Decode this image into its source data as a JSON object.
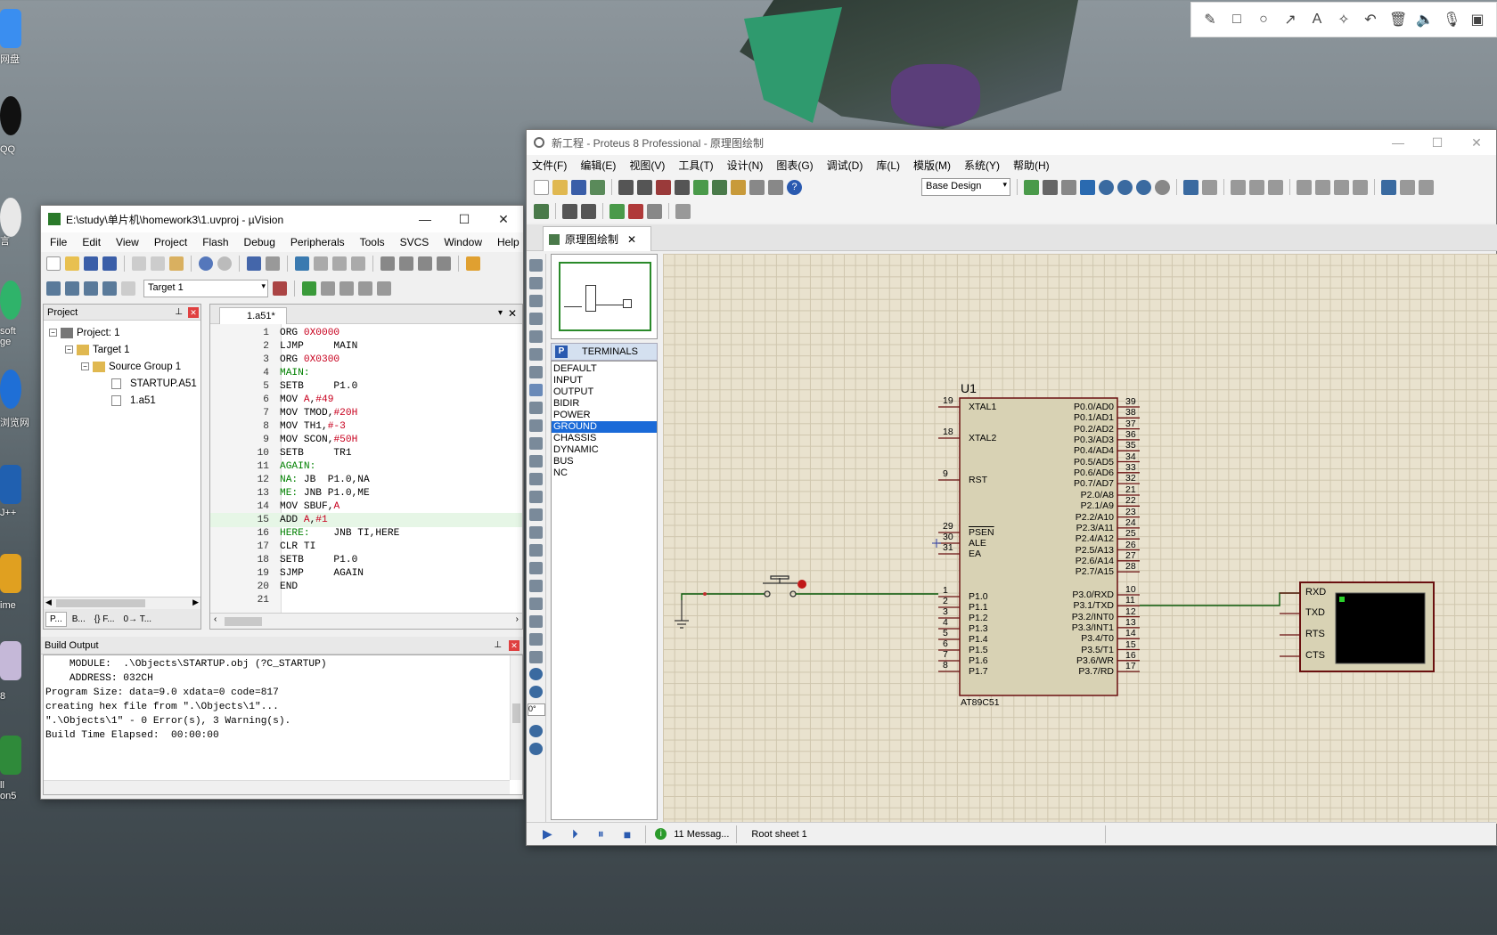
{
  "desktop": {
    "labels": [
      "网盘",
      "QQ",
      "言",
      "soft\nge",
      "浏览网",
      "J++",
      "ime",
      "8",
      "ll\non5"
    ]
  },
  "uvision": {
    "title": "E:\\study\\单片机\\homework3\\1.uvproj - µVision",
    "menu": [
      "File",
      "Edit",
      "View",
      "Project",
      "Flash",
      "Debug",
      "Peripherals",
      "Tools",
      "SVCS",
      "Window",
      "Help"
    ],
    "target": "Target 1",
    "project_panel_title": "Project",
    "tree": [
      {
        "label": "Project: 1",
        "level": 0
      },
      {
        "label": "Target 1",
        "level": 1
      },
      {
        "label": "Source Group 1",
        "level": 2
      },
      {
        "label": "STARTUP.A51",
        "level": 3
      },
      {
        "label": "1.a51",
        "level": 3
      }
    ],
    "panel_tabs": [
      "P...",
      "B...",
      "{} F...",
      "0→ T..."
    ],
    "editor_tab": "1.a51*",
    "code": [
      {
        "n": "1",
        "t": "ORG 0X0000"
      },
      {
        "n": "2",
        "t": "LJMP     MAIN"
      },
      {
        "n": "3",
        "t": "ORG 0X0300"
      },
      {
        "n": "4",
        "t": "MAIN:"
      },
      {
        "n": "5",
        "t": "SETB     P1.0"
      },
      {
        "n": "6",
        "t": "MOV A,#49"
      },
      {
        "n": "7",
        "t": "MOV TMOD,#20H"
      },
      {
        "n": "8",
        "t": "MOV TH1,#-3"
      },
      {
        "n": "9",
        "t": "MOV SCON,#50H"
      },
      {
        "n": "10",
        "t": "SETB     TR1"
      },
      {
        "n": "11",
        "t": "AGAIN:"
      },
      {
        "n": "12",
        "t": "NA: JB  P1.0,NA"
      },
      {
        "n": "13",
        "t": "ME: JNB P1.0,ME"
      },
      {
        "n": "14",
        "t": "MOV SBUF,A"
      },
      {
        "n": "15",
        "t": "ADD A,#1"
      },
      {
        "n": "16",
        "t": "HERE:    JNB TI,HERE"
      },
      {
        "n": "17",
        "t": "CLR TI"
      },
      {
        "n": "18",
        "t": "SETB     P1.0"
      },
      {
        "n": "19",
        "t": "SJMP     AGAIN"
      },
      {
        "n": "20",
        "t": "END"
      },
      {
        "n": "21",
        "t": ""
      }
    ],
    "build_title": "Build Output",
    "build": [
      "    MODULE:  .\\Objects\\STARTUP.obj (?C_STARTUP)",
      "    ADDRESS: 032CH",
      "Program Size: data=9.0 xdata=0 code=817",
      "creating hex file from \".\\Objects\\1\"...",
      "\".\\Objects\\1\" - 0 Error(s), 3 Warning(s).",
      "Build Time Elapsed:  00:00:00"
    ]
  },
  "proteus": {
    "title": "新工程 - Proteus 8 Professional - 原理图绘制",
    "menu": [
      "文件(F)",
      "编辑(E)",
      "视图(V)",
      "工具(T)",
      "设计(N)",
      "图表(G)",
      "调试(D)",
      "库(L)",
      "模版(M)",
      "系统(Y)",
      "帮助(H)"
    ],
    "design_select": "Base Design",
    "tab": "原理图绘制",
    "terminals_title": "TERMINALS",
    "terminals": [
      "DEFAULT",
      "INPUT",
      "OUTPUT",
      "BIDIR",
      "POWER",
      "GROUND",
      "CHASSIS",
      "DYNAMIC",
      "BUS",
      "NC"
    ],
    "terminals_selected": "GROUND",
    "rotation": "0°",
    "chip_ref": "U1",
    "chip_name": "AT89C51",
    "left_pins": [
      {
        "num": "19",
        "name": "XTAL1"
      },
      {
        "num": "18",
        "name": "XTAL2"
      },
      {
        "num": "9",
        "name": "RST"
      },
      {
        "num": "29",
        "name": "PSEN"
      },
      {
        "num": "30",
        "name": "ALE"
      },
      {
        "num": "31",
        "name": "EA"
      },
      {
        "num": "1",
        "name": "P1.0"
      },
      {
        "num": "2",
        "name": "P1.1"
      },
      {
        "num": "3",
        "name": "P1.2"
      },
      {
        "num": "4",
        "name": "P1.3"
      },
      {
        "num": "5",
        "name": "P1.4"
      },
      {
        "num": "6",
        "name": "P1.5"
      },
      {
        "num": "7",
        "name": "P1.6"
      },
      {
        "num": "8",
        "name": "P1.7"
      }
    ],
    "right_pins": [
      {
        "num": "39",
        "name": "P0.0/AD0"
      },
      {
        "num": "38",
        "name": "P0.1/AD1"
      },
      {
        "num": "37",
        "name": "P0.2/AD2"
      },
      {
        "num": "36",
        "name": "P0.3/AD3"
      },
      {
        "num": "35",
        "name": "P0.4/AD4"
      },
      {
        "num": "34",
        "name": "P0.5/AD5"
      },
      {
        "num": "33",
        "name": "P0.6/AD6"
      },
      {
        "num": "32",
        "name": "P0.7/AD7"
      },
      {
        "num": "21",
        "name": "P2.0/A8"
      },
      {
        "num": "22",
        "name": "P2.1/A9"
      },
      {
        "num": "23",
        "name": "P2.2/A10"
      },
      {
        "num": "24",
        "name": "P2.3/A11"
      },
      {
        "num": "25",
        "name": "P2.4/A12"
      },
      {
        "num": "26",
        "name": "P2.5/A13"
      },
      {
        "num": "27",
        "name": "P2.6/A14"
      },
      {
        "num": "28",
        "name": "P2.7/A15"
      },
      {
        "num": "10",
        "name": "P3.0/RXD"
      },
      {
        "num": "11",
        "name": "P3.1/TXD"
      },
      {
        "num": "12",
        "name": "P3.2/INT0"
      },
      {
        "num": "13",
        "name": "P3.3/INT1"
      },
      {
        "num": "14",
        "name": "P3.4/T0"
      },
      {
        "num": "15",
        "name": "P3.5/T1"
      },
      {
        "num": "16",
        "name": "P3.6/WR"
      },
      {
        "num": "17",
        "name": "P3.7/RD"
      }
    ],
    "terminal_pins": [
      "RXD",
      "TXD",
      "RTS",
      "CTS"
    ],
    "status": {
      "messages": "11 Messag...",
      "sheet": "Root sheet 1"
    }
  }
}
